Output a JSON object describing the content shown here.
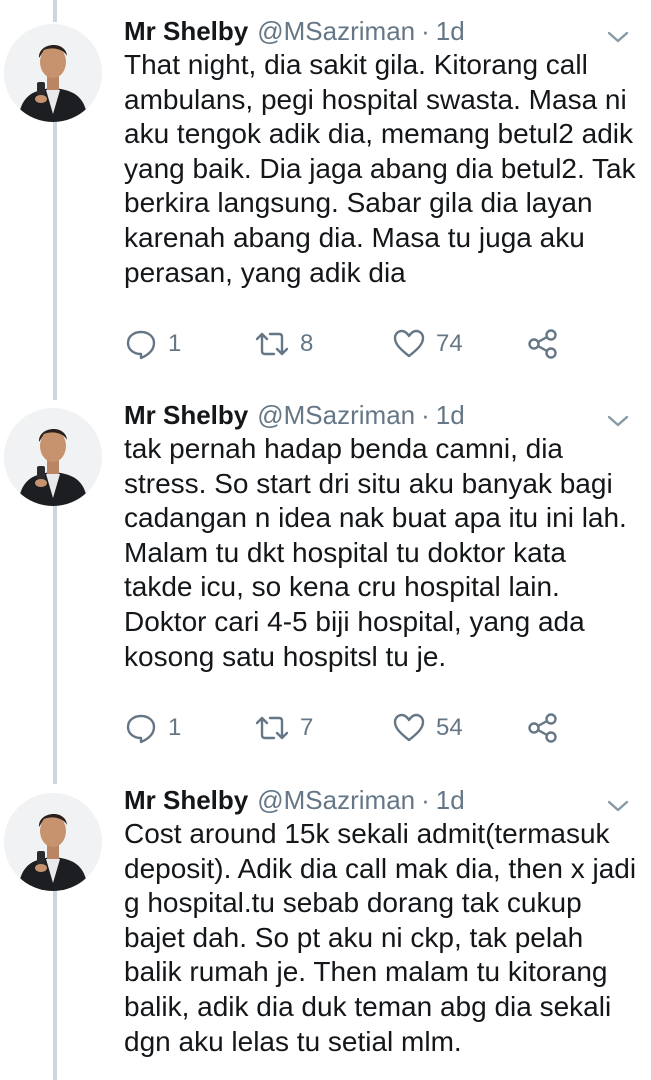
{
  "tweets": [
    {
      "author": {
        "name": "Mr Shelby",
        "handle": "@MSazriman"
      },
      "separator": "·",
      "time": "1d",
      "text_lines": [
        "That night, dia sakit gila. Kitorang call",
        "ambulans, pegi hospital swasta.  Masa ni",
        "aku tengok adik dia, memang betul2 adik",
        "yang baik. Dia jaga abang dia betul2. Tak",
        "berkira langsung. Sabar gila dia layan",
        "karenah abang dia. Masa tu juga aku",
        "perasan, yang adik dia"
      ],
      "replies": "1",
      "retweets": "8",
      "likes": "74"
    },
    {
      "author": {
        "name": "Mr Shelby",
        "handle": "@MSazriman"
      },
      "separator": "·",
      "time": "1d",
      "text_lines": [
        "tak pernah hadap benda camni, dia",
        "stress. So start dri situ aku banyak bagi",
        "cadangan n idea nak buat apa itu ini lah.",
        "Malam tu dkt hospital tu doktor kata",
        "takde icu, so kena cru hospital lain.",
        "Doktor cari 4-5 biji hospital, yang ada",
        "kosong satu hospitsl tu je."
      ],
      "replies": "1",
      "retweets": "7",
      "likes": "54"
    },
    {
      "author": {
        "name": "Mr Shelby",
        "handle": "@MSazriman"
      },
      "separator": "·",
      "time": "1d",
      "text_lines": [
        "Cost around 15k sekali admit(termasuk",
        "deposit). Adik dia call mak dia, then x jadi",
        "g hospital.tu sebab dorang tak cukup",
        "bajet dah. So pt aku ni ckp, tak pelah",
        "balik rumah je. Then malam tu kitorang",
        "balik, adik dia duk teman abg dia sekali",
        "dgn aku lelas tu setial mlm."
      ]
    }
  ],
  "icons": {
    "avatar": "profile-photo",
    "more": "chevron-down-icon",
    "reply": "speech-bubble-icon",
    "retweet": "retweet-arrows-icon",
    "like": "heart-icon",
    "share": "share-nodes-icon"
  },
  "colors": {
    "text": "#14171a",
    "secondary": "#657786",
    "thread_line": "#ccd6dd",
    "background": "#ffffff"
  }
}
